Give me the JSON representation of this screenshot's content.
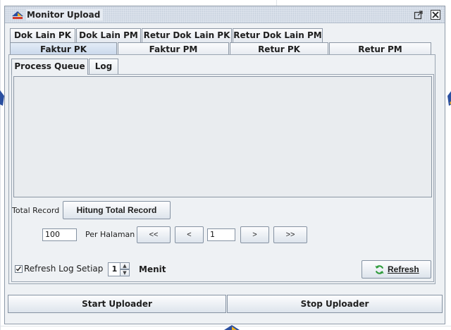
{
  "window": {
    "title": "Monitor Upload",
    "icon": "taxpayer-app-icon",
    "controls": [
      "restore-icon",
      "close-icon"
    ]
  },
  "top_tabs_row1": [
    {
      "label": "Dok Lain PK"
    },
    {
      "label": "Dok Lain PM"
    },
    {
      "label": "Retur Dok Lain PK"
    },
    {
      "label": "Retur Dok Lain PM"
    }
  ],
  "top_tabs_row2": [
    {
      "label": "Faktur PK",
      "selected": true
    },
    {
      "label": "Faktur PM"
    },
    {
      "label": "Retur PK"
    },
    {
      "label": "Retur PM"
    }
  ],
  "inner_tabs": [
    {
      "label": "Process Queue",
      "selected": true
    },
    {
      "label": "Log"
    }
  ],
  "record": {
    "total_label": "Total Record",
    "count_button": "Hitung Total Record"
  },
  "paging": {
    "page_size": "100",
    "per_page_label": "Per Halaman",
    "first": "<<",
    "prev": "<",
    "page": "1",
    "next": ">",
    "last": ">>"
  },
  "refresh": {
    "checkbox_label": "Refresh Log Setiap",
    "checked": true,
    "interval": "1",
    "unit": "Menit",
    "button_label": "Refresh",
    "icon": "refresh-icon"
  },
  "actions": {
    "start": "Start Uploader",
    "stop": "Stop Uploader"
  },
  "colors": {
    "window_bg": "#eef1f4",
    "selected_tab": "#c7d6ea",
    "border": "#8d98a6",
    "refresh_icon": "#2e9b3a"
  }
}
